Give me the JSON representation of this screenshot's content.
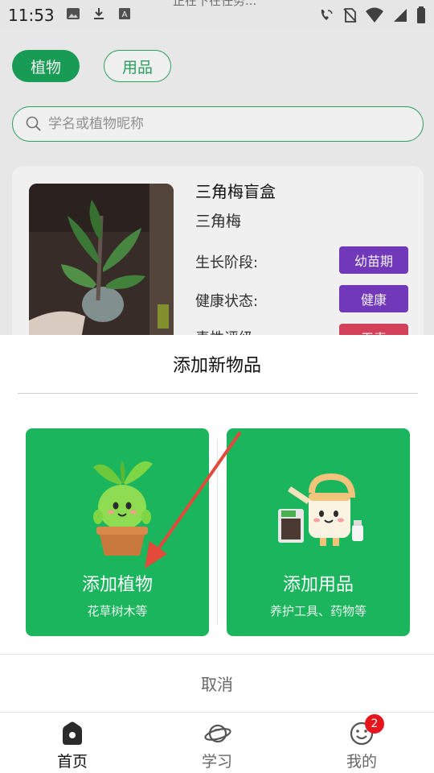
{
  "status_bar": {
    "time": "11:53",
    "ghost_text": "正在下在任务..."
  },
  "home": {
    "tabs": [
      {
        "label": "植物",
        "active": true
      },
      {
        "label": "用品",
        "active": false
      }
    ],
    "search": {
      "placeholder": "学名或植物昵称",
      "value": ""
    },
    "plant_card": {
      "title": "三角梅盲盒",
      "species": "三角梅",
      "rows": [
        {
          "label": "生长阶段:",
          "value": "幼苗期",
          "color": "#7a3cc6"
        },
        {
          "label": "健康状态:",
          "value": "健康",
          "color": "#7a3cc6"
        },
        {
          "label": "毒性评级",
          "value": "无毒",
          "color": "#e0455f"
        }
      ]
    }
  },
  "sheet": {
    "title": "添加新物品",
    "options": [
      {
        "label": "添加植物",
        "desc": "花草树木等",
        "icon": "potted-sprout-icon"
      },
      {
        "label": "添加用品",
        "desc": "养护工具、药物等",
        "icon": "watering-can-icon"
      }
    ],
    "cancel_label": "取消",
    "accent_color": "#1ab55c"
  },
  "bottom_nav": {
    "items": [
      {
        "label": "首页",
        "icon": "home-icon",
        "active": true
      },
      {
        "label": "学习",
        "icon": "planet-icon",
        "active": false
      },
      {
        "label": "我的",
        "icon": "smiley-icon",
        "active": false,
        "badge": "2"
      }
    ]
  }
}
